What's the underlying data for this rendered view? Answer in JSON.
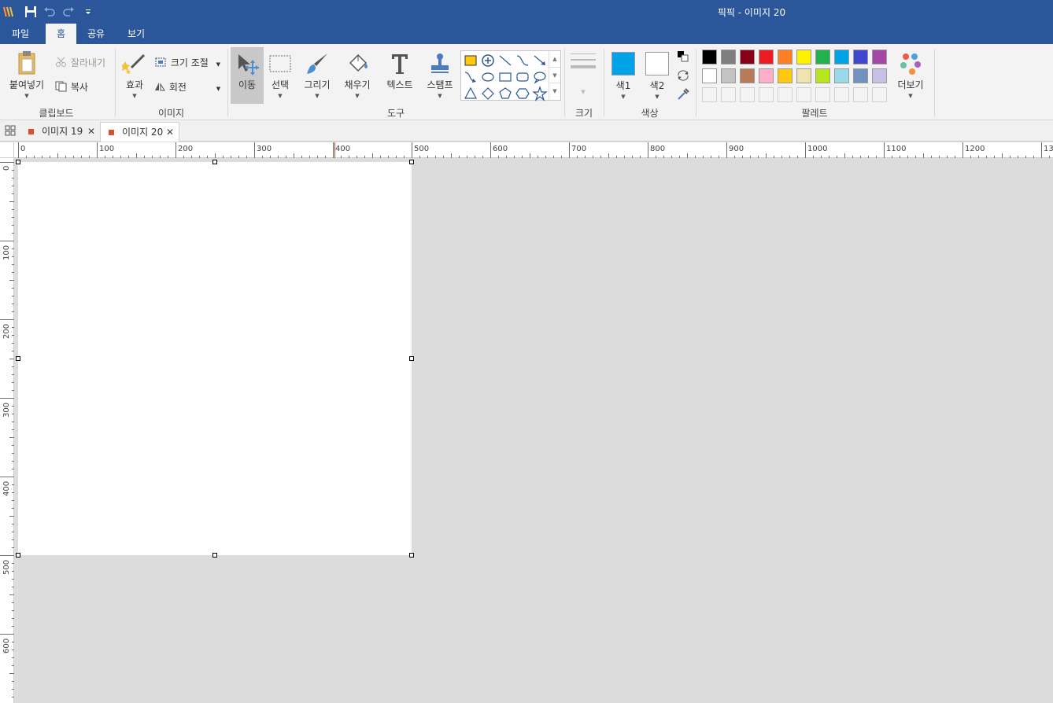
{
  "window": {
    "title": "픽픽 - 이미지 20"
  },
  "menu": {
    "tabs": [
      "파일",
      "홈",
      "공유",
      "보기"
    ],
    "active": "홈"
  },
  "ribbon": {
    "clipboard": {
      "paste": "붙여넣기",
      "cut": "잘라내기",
      "copy": "복사",
      "label": "클립보드"
    },
    "image": {
      "effects": "효과",
      "resize": "크기 조절",
      "rotate": "회전",
      "label": "이미지"
    },
    "tools": {
      "move": "이동",
      "select": "선택",
      "draw": "그리기",
      "fill": "채우기",
      "text": "텍스트",
      "stamp": "스탬프",
      "label": "도구"
    },
    "size": {
      "label": "크기"
    },
    "color": {
      "color1": "색1",
      "color2": "색2",
      "label": "색상",
      "color1_value": "#00a2e8",
      "color2_value": "#ffffff"
    },
    "palette": {
      "label": "팔레트",
      "more": "더보기",
      "row1": [
        "#000000",
        "#7f7f7f",
        "#880015",
        "#ed1c24",
        "#ff7f27",
        "#fff200",
        "#22b14c",
        "#00a2e8",
        "#3f48cc",
        "#a349a4"
      ],
      "row2": [
        "#ffffff",
        "#c3c3c3",
        "#b97a57",
        "#ffaec9",
        "#ffc90e",
        "#efe4b0",
        "#b5e61d",
        "#99d9ea",
        "#7092be",
        "#c8bfe7"
      ]
    }
  },
  "doc_tabs": [
    {
      "label": "이미지 19",
      "active": false
    },
    {
      "label": "이미지 20",
      "active": true
    }
  ],
  "ruler": {
    "h_labels": [
      "0",
      "100",
      "200",
      "300",
      "400",
      "500",
      "600",
      "700",
      "800",
      "900",
      "1000",
      "1100",
      "1200",
      "13"
    ],
    "v_labels": [
      "0",
      "100",
      "200",
      "300",
      "400",
      "500",
      "600"
    ],
    "cursor_marker": 400
  },
  "canvas": {
    "width": 500,
    "height": 500
  }
}
